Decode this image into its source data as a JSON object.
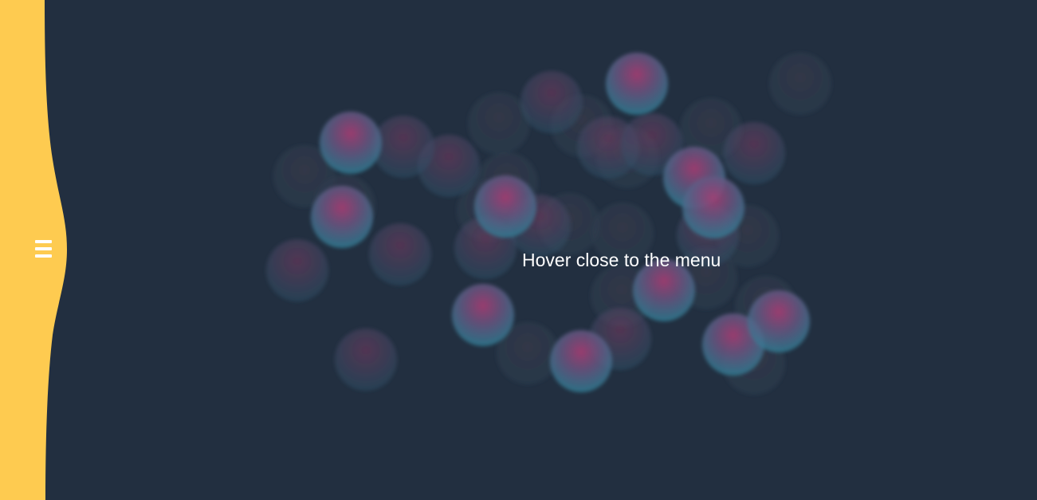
{
  "colors": {
    "background": "#222f40",
    "sidebar": "#fecb50",
    "bubble_teal": "#2f7f96",
    "bubble_pink": "#a63d73",
    "text": "#ffffff"
  },
  "menu": {
    "icon": "hamburger-menu-icon"
  },
  "hint": {
    "text": "Hover close to the menu"
  }
}
